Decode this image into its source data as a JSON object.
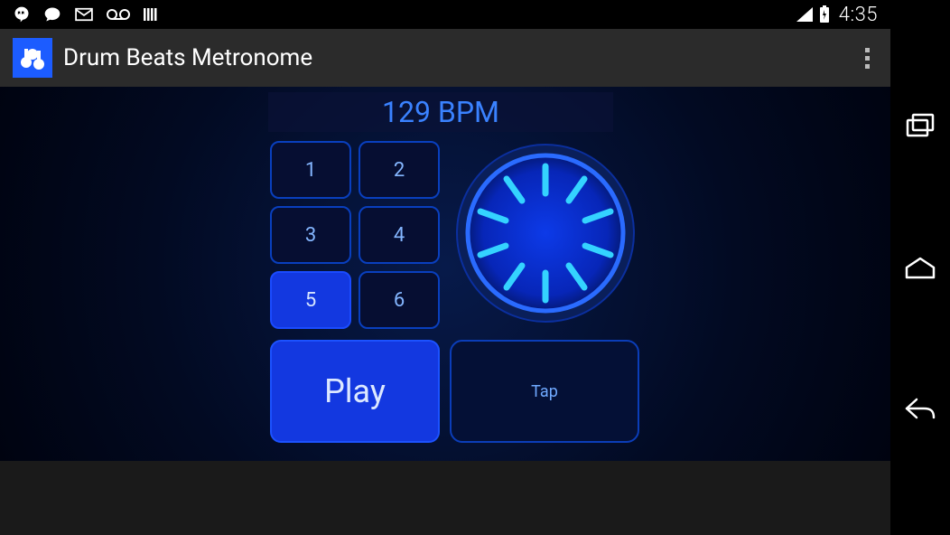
{
  "status": {
    "time": "4:35"
  },
  "app": {
    "title": "Drum Beats Metronome"
  },
  "bpm": {
    "display": "129 BPM"
  },
  "keys": {
    "k1": "1",
    "k2": "2",
    "k3": "3",
    "k4": "4",
    "k5": "5",
    "k6": "6"
  },
  "play_label": "Play",
  "tap_label": "Tap"
}
